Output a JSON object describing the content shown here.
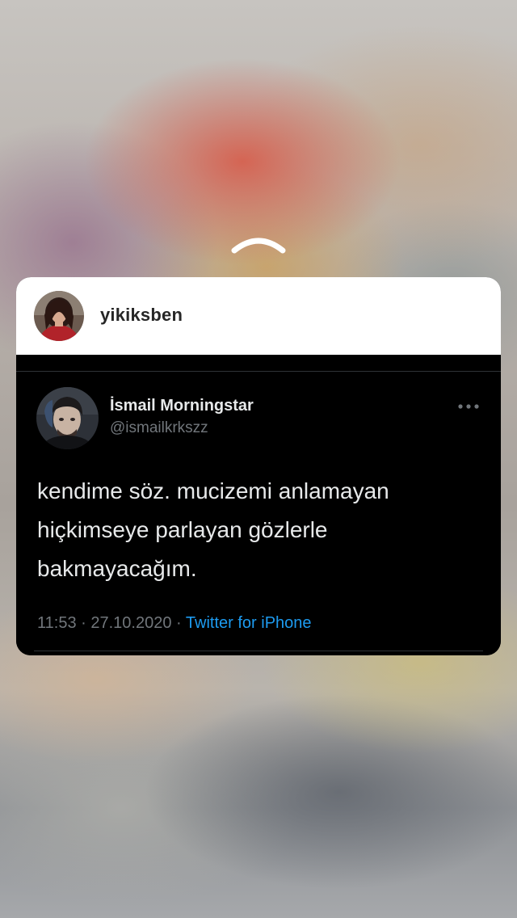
{
  "story": {
    "poster": {
      "username": "yikiksben",
      "avatar_icon": "profile-photo"
    },
    "swipe_up_icon": "chevron-up-icon"
  },
  "tweet": {
    "display_name": "İsmail Morningstar",
    "handle": "@ismailkrkszz",
    "text": "kendime söz. mucizemi anlamayan\nhiçkimseye parlayan gözlerle\nbakmayacağım.",
    "time": "11:53",
    "separator": "·",
    "date": "27.10.2020",
    "source": "Twitter for iPhone",
    "more_icon": "more-icon"
  },
  "colors": {
    "tweet_background": "#000000",
    "header_background": "#ffffff",
    "link_blue": "#1d9bf0",
    "secondary_text": "#71767b",
    "primary_text": "#e7e9ea"
  }
}
